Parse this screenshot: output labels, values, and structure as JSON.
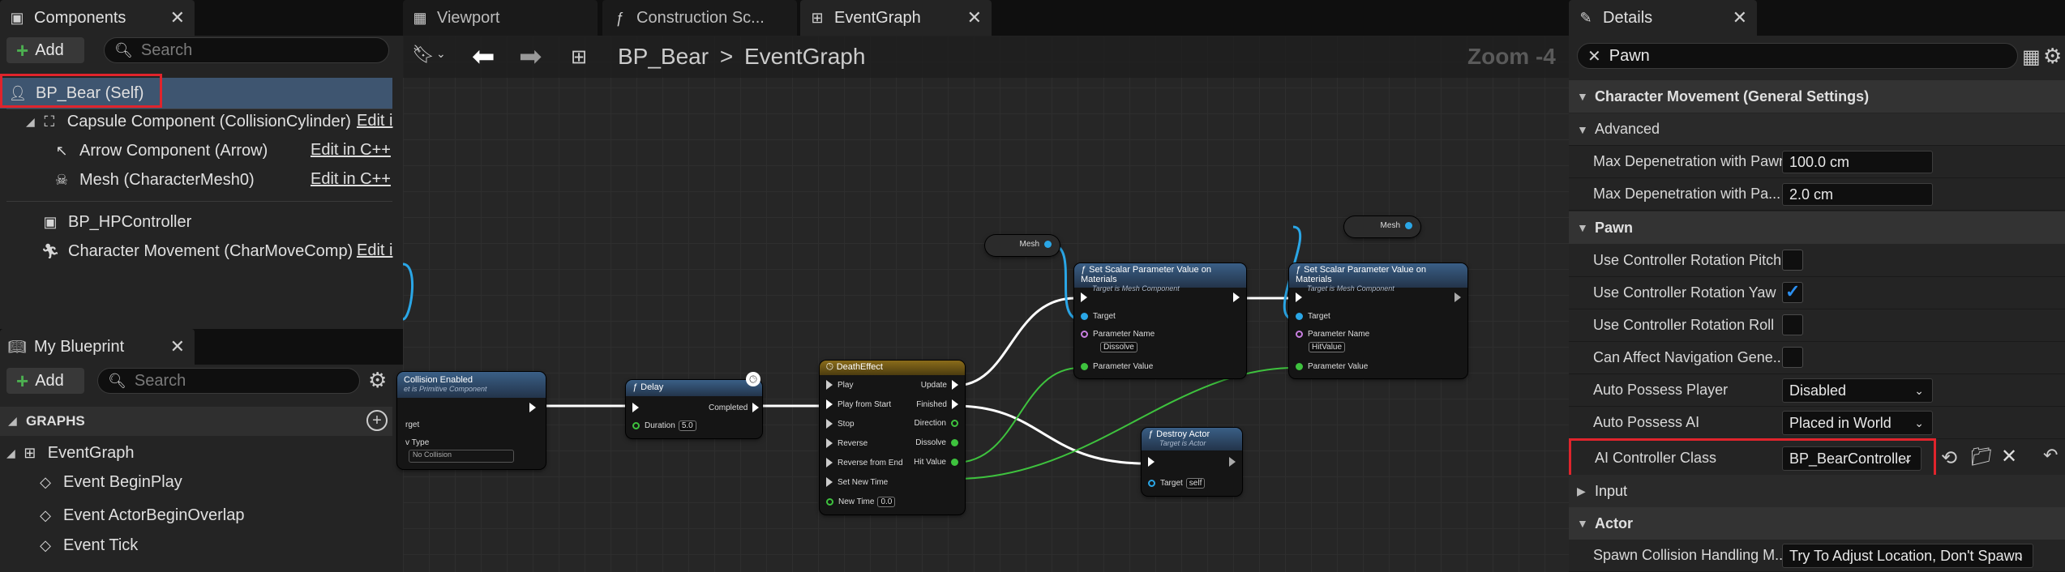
{
  "components_panel": {
    "tab_title": "Components",
    "add_label": "Add",
    "search_placeholder": "Search",
    "items": [
      {
        "label": "BP_Bear (Self)"
      },
      {
        "label": "Capsule Component (CollisionCylinder)",
        "edit": "Edit i"
      },
      {
        "label": "Arrow Component (Arrow)",
        "edit": "Edit in C++"
      },
      {
        "label": "Mesh (CharacterMesh0)",
        "edit": "Edit in C++"
      },
      {
        "label": "BP_HPController"
      },
      {
        "label": "Character Movement (CharMoveComp)",
        "edit": "Edit i"
      }
    ]
  },
  "my_blueprint": {
    "tab_title": "My Blueprint",
    "add_label": "Add",
    "search_placeholder": "Search",
    "graphs_label": "GRAPHS",
    "items": [
      "EventGraph",
      "Event BeginPlay",
      "Event ActorBeginOverlap",
      "Event Tick"
    ]
  },
  "editor_tabs": {
    "viewport": "Viewport",
    "construction": "Construction Sc...",
    "eventgraph": "EventGraph"
  },
  "graph": {
    "breadcrumb_root": "BP_Bear",
    "breadcrumb_separator": ">",
    "breadcrumb_leaf": "EventGraph",
    "zoom": "Zoom -4",
    "nodes": {
      "mesh1": "Mesh",
      "mesh2": "Mesh",
      "set_scalar_title": "Set Scalar Parameter Value on Materials",
      "set_scalar_sub": "Target is Mesh Component",
      "target": "Target",
      "parameter_name": "Parameter Name",
      "parameter_value": "Parameter Value",
      "param1": "Dissolve",
      "param2": "HitValue",
      "collision_title": "Collision Enabled",
      "collision_sub": "et is Primitive Component",
      "collision_row1": "rget",
      "collision_row2": "v Type",
      "collision_combo": "No Collision",
      "delay_title": "Delay",
      "completed": "Completed",
      "duration": "Duration",
      "duration_value": "5.0",
      "timeline_title": "DeathEffect",
      "play": "Play",
      "play_from_start": "Play from Start",
      "stop": "Stop",
      "reverse": "Reverse",
      "reverse_from_end": "Reverse from End",
      "set_new_time": "Set New Time",
      "new_time": "New Time",
      "new_time_value": "0.0",
      "update": "Update",
      "finished": "Finished",
      "direction": "Direction",
      "dissolve": "Dissolve",
      "hit_value": "Hit Value",
      "destroy_title": "Destroy Actor",
      "destroy_sub": "Target is Actor",
      "destroy_target": "Target",
      "self_value": "self"
    }
  },
  "details": {
    "tab_title": "Details",
    "search_value": "Pawn",
    "sections": {
      "char_movement": "Character Movement (General Settings)",
      "advanced": "Advanced",
      "pawn": "Pawn",
      "input": "Input",
      "actor": "Actor"
    },
    "rows": {
      "max_depen_pawn": {
        "label": "Max Depenetration with Pawn",
        "value": "100.0 cm"
      },
      "max_depen_pa": {
        "label": "Max Depenetration with Pa...",
        "value": "2.0 cm"
      },
      "use_pitch": {
        "label": "Use Controller Rotation Pitch",
        "checked": false
      },
      "use_yaw": {
        "label": "Use Controller Rotation Yaw",
        "checked": true
      },
      "use_roll": {
        "label": "Use Controller Rotation Roll",
        "checked": false
      },
      "can_affect_nav": {
        "label": "Can Affect Navigation Gene...",
        "checked": false
      },
      "auto_possess_player": {
        "label": "Auto Possess Player",
        "value": "Disabled"
      },
      "auto_possess_ai": {
        "label": "Auto Possess AI",
        "value": "Placed in World"
      },
      "ai_controller_class": {
        "label": "AI Controller Class",
        "value": "BP_BearController"
      },
      "spawn_collision": {
        "label": "Spawn Collision Handling M...",
        "value": "Try To Adjust Location, Don't Spawn"
      }
    }
  },
  "colors": {
    "highlight": "#e0242c",
    "selection": "#3e5570",
    "function_header": "#3a5f86",
    "timeline_header": "#8a6c1a",
    "exec_wire": "#ffffff",
    "float_wire": "#3ec23e",
    "object_wire": "#2aa6e6"
  }
}
